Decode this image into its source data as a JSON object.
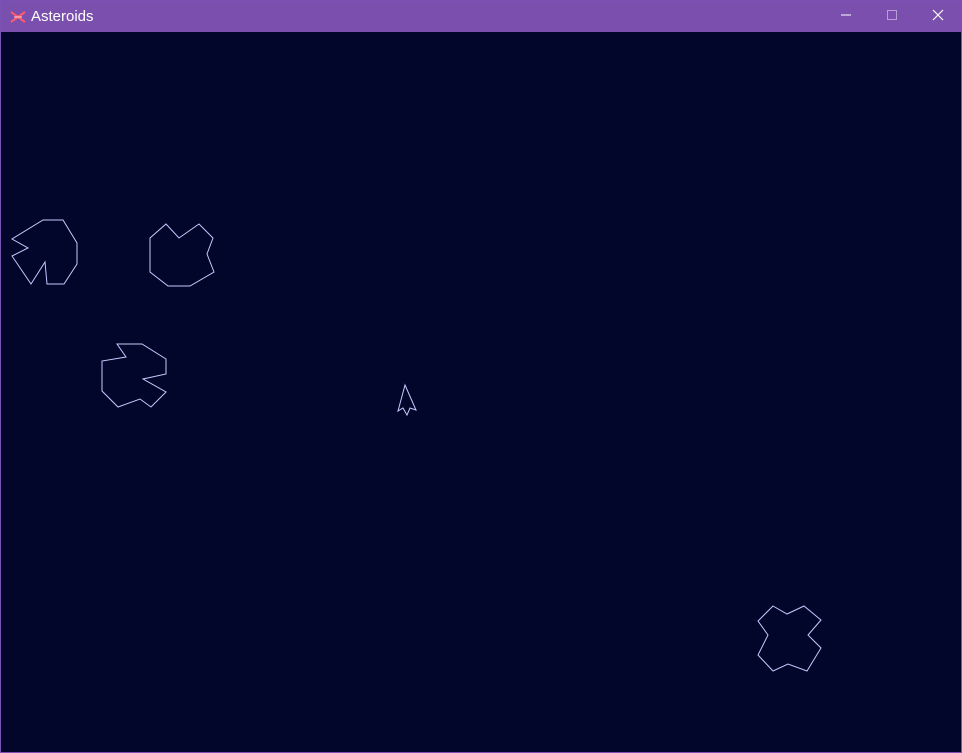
{
  "window": {
    "title": "Asteroids",
    "app_icon": "asteroids-x-icon",
    "controls": {
      "minimize_icon": "minimize-icon",
      "maximize_icon": "maximize-icon",
      "close_icon": "close-icon"
    }
  },
  "game": {
    "background_color": "#02062a",
    "line_color": "#c9c9ff",
    "objects": [
      {
        "type": "asteroid",
        "name": "asteroid-1"
      },
      {
        "type": "asteroid",
        "name": "asteroid-2"
      },
      {
        "type": "asteroid",
        "name": "asteroid-3"
      },
      {
        "type": "asteroid",
        "name": "asteroid-4"
      },
      {
        "type": "ship",
        "name": "player-ship"
      }
    ]
  },
  "colors": {
    "titlebar": "#7a4fad",
    "icon_accent": "#ff5a6e"
  }
}
